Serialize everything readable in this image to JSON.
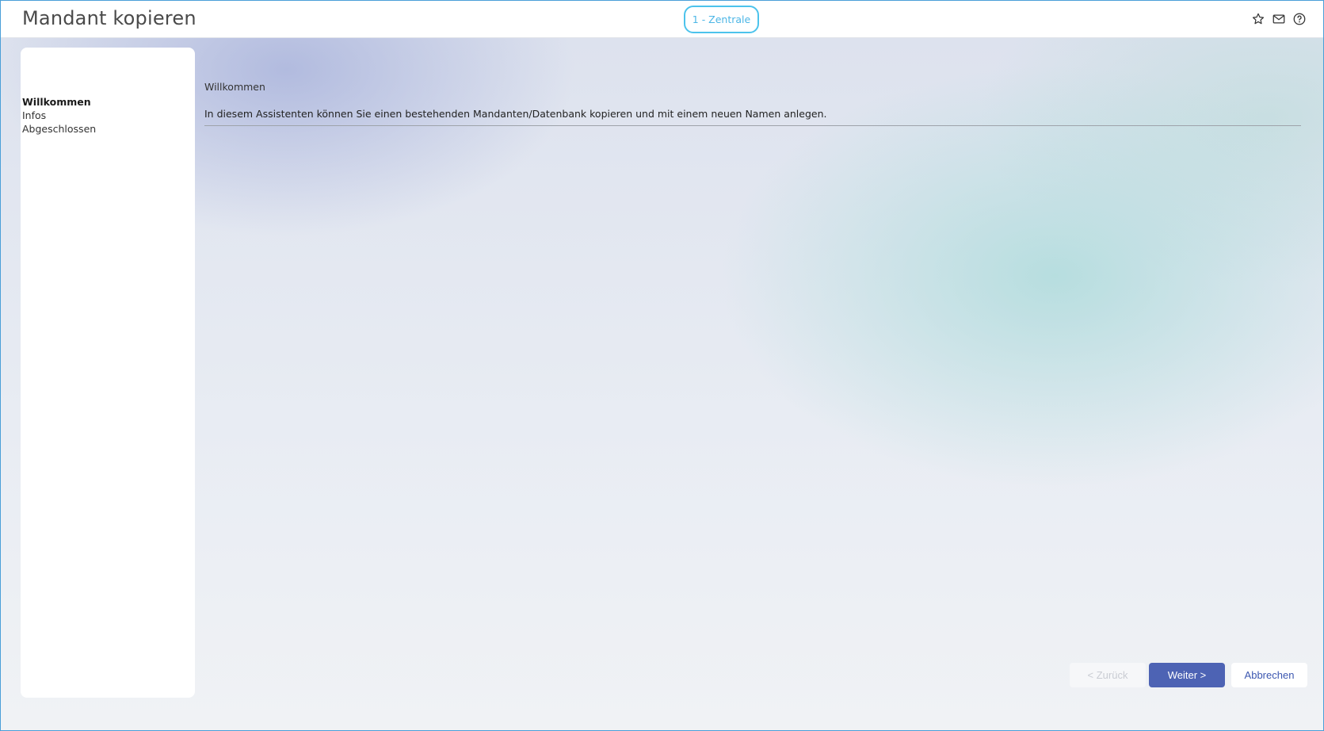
{
  "header": {
    "title": "Mandant kopieren",
    "tenant": "1 - Zentrale",
    "icons": [
      "star-icon",
      "mail-icon",
      "help-icon"
    ]
  },
  "steps": [
    {
      "label": "Willkommen",
      "active": true
    },
    {
      "label": "Infos",
      "active": false
    },
    {
      "label": "Abgeschlossen",
      "active": false
    }
  ],
  "main": {
    "section_title": "Willkommen",
    "intro": "In diesem Assistenten können Sie einen bestehenden Mandanten/Datenbank kopieren und mit einem neuen Namen anlegen."
  },
  "footer": {
    "back_label": "< Zurück",
    "next_label": "Weiter >",
    "cancel_label": "Abbrechen"
  },
  "colors": {
    "accent": "#4d63b4",
    "badge": "#4cc3ec"
  }
}
